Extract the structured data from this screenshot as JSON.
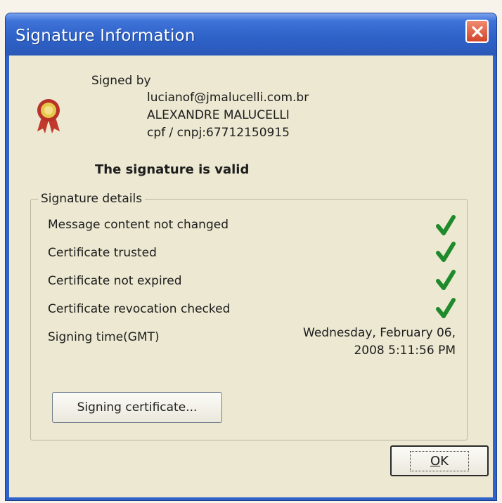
{
  "window": {
    "title": "Signature Information"
  },
  "signer": {
    "signed_by_label": "Signed by",
    "email": "lucianof@jmalucelli.com.br",
    "name": "ALEXANDRE MALUCELLI",
    "id": "cpf / cnpj:67712150915"
  },
  "status": "The signature is valid",
  "details": {
    "legend": "Signature details",
    "checks": [
      {
        "label": "Message content not changed",
        "icon": "check-icon"
      },
      {
        "label": "Certificate trusted",
        "icon": "check-icon"
      },
      {
        "label": "Certificate not expired",
        "icon": "check-icon"
      },
      {
        "label": "Certificate revocation checked",
        "icon": "check-icon"
      }
    ],
    "signing_time_label": "Signing time(GMT)",
    "signing_time_line1": "Wednesday, February 06,",
    "signing_time_line2": "2008 5:11:56 PM",
    "certificate_button": "Signing certificate..."
  },
  "buttons": {
    "ok_prefix": "O",
    "ok_suffix": "K"
  },
  "colors": {
    "titlebar": "#2f63c9",
    "client": "#ece8d1",
    "check": "#1f8a2b",
    "close": "#d2452a"
  }
}
